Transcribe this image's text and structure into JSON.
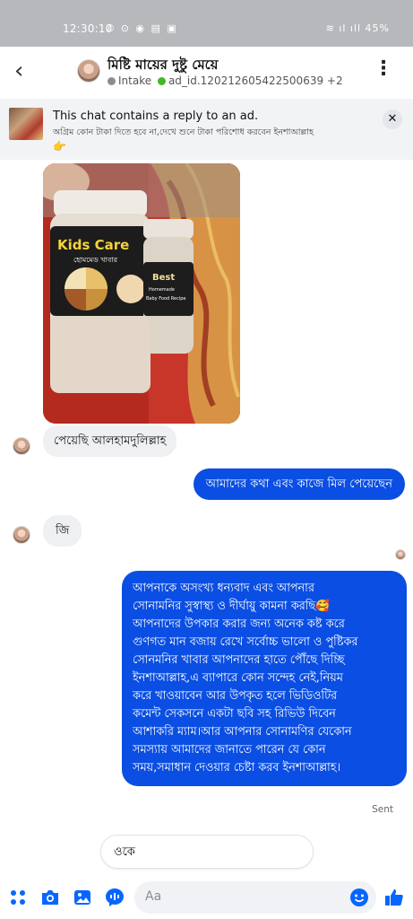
{
  "status_bar": {
    "time": "12:30:10",
    "left_icons": "✆ ⊙ ◉ ▤ ▣",
    "right": "≋ ıl ıll 45%"
  },
  "header": {
    "name": "মিষ্টি মায়ের দুষ্টু মেয়ে",
    "label_intake": "Intake",
    "ad_id": "ad_id.120212605422500639 +2",
    "back_icon": "back-chevron-icon",
    "menu_icon": "vertical-ellipsis-icon"
  },
  "ad_banner": {
    "title": "This chat contains a reply to an ad.",
    "text": "অগ্রিম কোন টাকা দিতে হবে না,দেখে শুনে টাকা পরিশোধ করবেন ইনশাআল্লাহ",
    "emoji": "👉",
    "close_symbol": "✕"
  },
  "product_photo": {
    "jar_big_line1": "Kids Care",
    "jar_big_line2": "হোমমেড খাবার",
    "jar_small_line1": "Best",
    "jar_small_line2": "Homemade",
    "jar_small_line3": "Baby Food Recipe"
  },
  "messages": [
    {
      "from": "them",
      "text": "পেয়েছি আলহামদুলিল্লাহ"
    },
    {
      "from": "me",
      "text": "আমাদের কথা এবং কাজে মিল পেয়েছেন"
    },
    {
      "from": "them",
      "text": "জি"
    },
    {
      "from": "me",
      "lines": [
        "আপনাকে অসংখ্য ধন্যবাদ এবং আপনার",
        "সোনামনির সুস্বাস্থ্য ও দীর্ঘায়ু কামনা করছি🥰",
        "আপনাদের উপকার করার জন্য অনেক কষ্ট করে",
        "গুণগত মান বজায় রেখে সর্বোচ্চ ভালো ও পুষ্টিকর",
        "সোনমনির খাবার আপনাদের হাতে পৌঁছে দিচ্ছি",
        "ইনশাআল্লাহ,এ ব্যাপারে কোন সন্দেহ নেই,নিয়ম",
        "করে খাওয়াবেন আর উপকৃত হলে ভিডিওটির",
        "কমেন্ট সেকসনে একটা ছবি সহ রিভিউ দিবেন",
        "আশাকরি ম্যাম।আর আপনার সোনামণির যেকোন",
        "সমস্যায় আমাদের জানাতে পারেন যে কোন",
        "সময়,সমাধান দেওয়ার চেষ্টা করব ইনশাআল্লাহ।"
      ]
    }
  ],
  "sent_status": "Sent",
  "typing_draft": "ওকে",
  "composer": {
    "placeholder": "Aa",
    "icons": [
      "apps-grid-icon",
      "camera-icon",
      "gallery-icon",
      "voice-message-icon",
      "emoji-icon",
      "thumbs-up-icon"
    ]
  },
  "colors": {
    "outgoing_bubble": "#0a4ee3",
    "incoming_bubble": "#eff0f2",
    "accent": "#0866ff",
    "status_bar": "#b6b8bc"
  }
}
